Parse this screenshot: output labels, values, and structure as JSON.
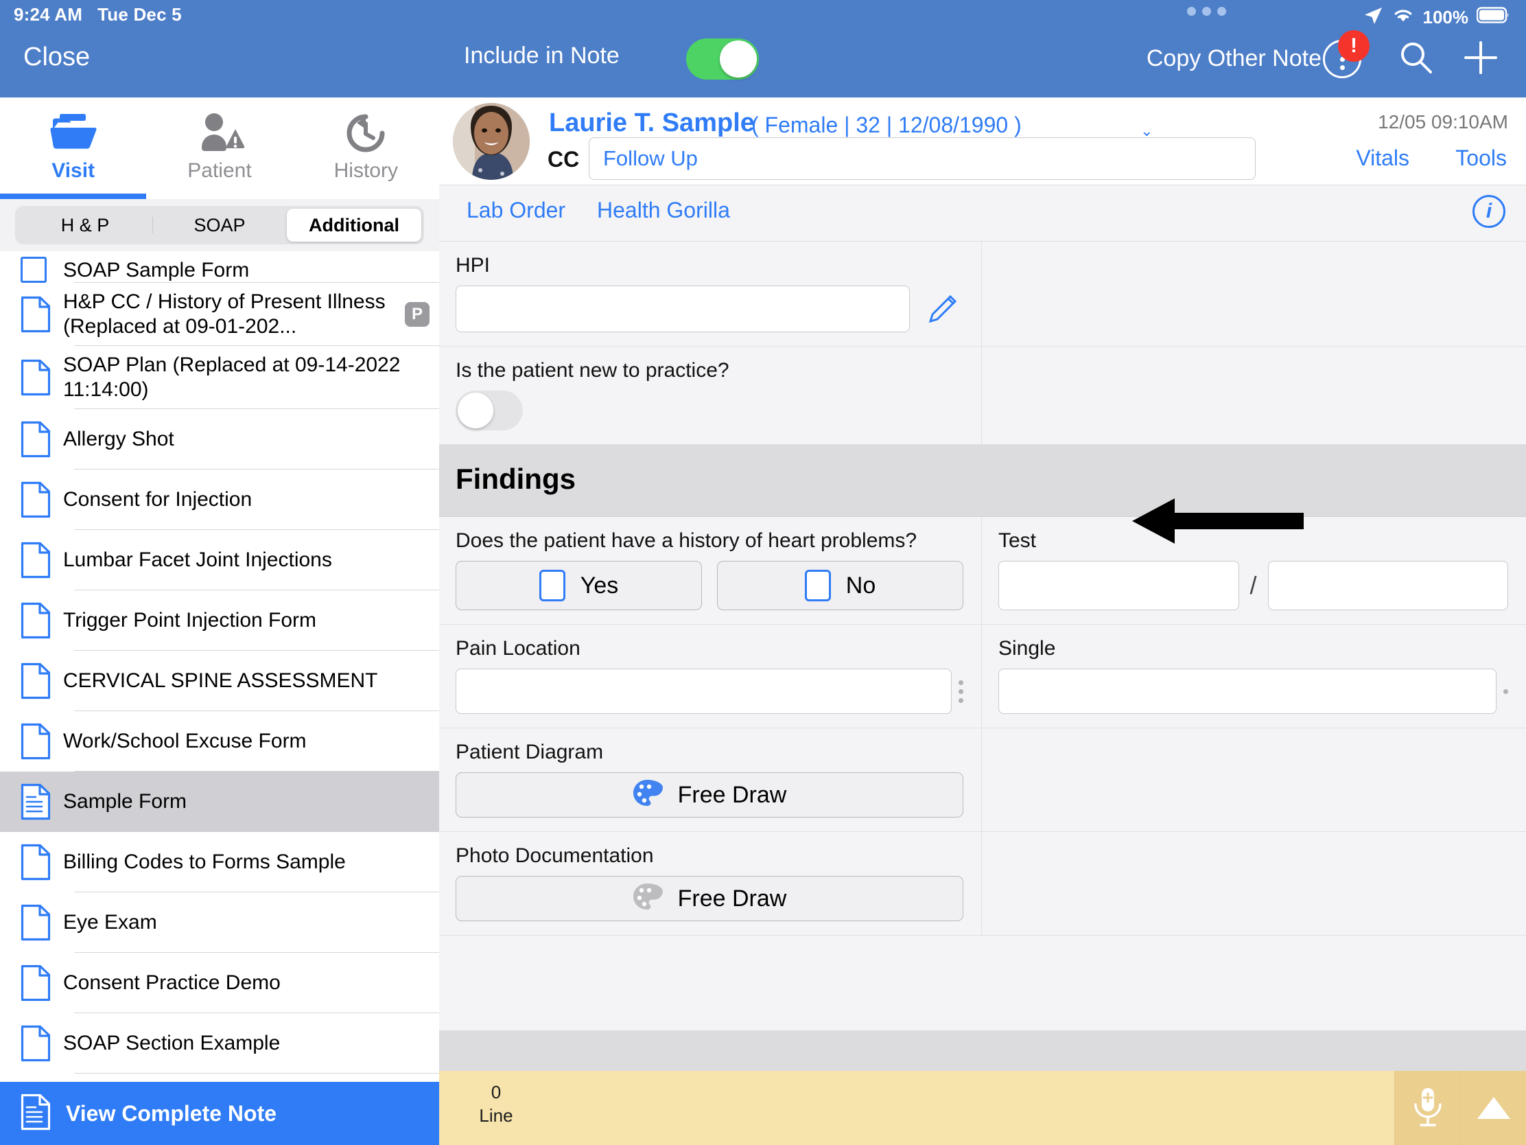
{
  "status_bar": {
    "time": "9:24 AM",
    "date": "Tue Dec 5",
    "battery_pct": "100%"
  },
  "left_panel": {
    "close_label": "Close",
    "tabs": [
      {
        "label": "Visit",
        "icon": "folder-icon",
        "active": true
      },
      {
        "label": "Patient",
        "icon": "person-warning-icon",
        "active": false
      },
      {
        "label": "History",
        "icon": "clock-history-icon",
        "active": false
      }
    ],
    "segmented": [
      {
        "label": "H & P",
        "selected": false
      },
      {
        "label": "SOAP",
        "selected": false
      },
      {
        "label": "Additional",
        "selected": true
      }
    ],
    "forms": [
      {
        "label": "SOAP Sample Form",
        "icon": "checkbox-icon",
        "clipped": true
      },
      {
        "label": "H&P CC / History of Present Illness (Replaced at 09-01-202...",
        "icon": "document-icon",
        "badge": "P"
      },
      {
        "label": "SOAP Plan (Replaced at 09-14-2022 11:14:00)",
        "icon": "document-icon"
      },
      {
        "label": "Allergy Shot",
        "icon": "document-icon"
      },
      {
        "label": "Consent for Injection",
        "icon": "document-icon"
      },
      {
        "label": "Lumbar Facet Joint Injections",
        "icon": "document-icon"
      },
      {
        "label": "Trigger Point Injection Form",
        "icon": "document-icon"
      },
      {
        "label": "CERVICAL SPINE ASSESSMENT",
        "icon": "document-icon"
      },
      {
        "label": "Work/School Excuse Form",
        "icon": "document-icon"
      },
      {
        "label": "Sample Form",
        "icon": "document-lines-icon",
        "selected": true
      },
      {
        "label": "Billing Codes to Forms Sample",
        "icon": "document-icon"
      },
      {
        "label": "Eye Exam",
        "icon": "document-icon"
      },
      {
        "label": "Consent Practice Demo",
        "icon": "document-icon"
      },
      {
        "label": "SOAP Section Example",
        "icon": "document-icon"
      }
    ],
    "view_complete_note": "View Complete Note"
  },
  "header": {
    "include_in_note_label": "Include in Note",
    "include_in_note_on": true,
    "copy_other_note_label": "Copy Other Note",
    "alert_badge": "!",
    "search_icon": "search-icon",
    "add_icon": "plus-icon"
  },
  "patient": {
    "name": "Laurie T. Sample",
    "demographics": "( Female | 32 | 12/08/1990 )",
    "cc_label": "CC",
    "cc_value": "Follow Up",
    "visit_timestamp": "12/05 09:10AM",
    "vitals_label": "Vitals",
    "tools_label": "Tools"
  },
  "order_bar": {
    "lab_order": "Lab Order",
    "health_gorilla": "Health Gorilla",
    "info_icon": "info-icon"
  },
  "form": {
    "hpi_label": "HPI",
    "hpi_value": "",
    "pencil_icon": "pencil-icon",
    "new_patient_question": "Is the patient new to practice?",
    "new_patient_toggle_on": false,
    "findings_title": "Findings",
    "heart_question": "Does the patient have a history of heart problems?",
    "yes_label": "Yes",
    "no_label": "No",
    "yes_checked": false,
    "no_checked": false,
    "pain_location_label": "Pain Location",
    "pain_location_value": "",
    "test_label": "Test",
    "test_value_1": "",
    "test_separator": "/",
    "test_value_2": "",
    "single_label": "Single",
    "single_value": "",
    "patient_diagram_label": "Patient Diagram",
    "patient_diagram_button": "Free Draw",
    "photo_documentation_label": "Photo Documentation",
    "photo_documentation_button": "Free Draw"
  },
  "bottom_bar": {
    "count": "0",
    "count_label": "Line",
    "mic_icon": "microphone-plus-icon",
    "collapse_icon": "triangle-up-icon"
  },
  "colors": {
    "header_blue": "#4d7ec8",
    "accent_blue": "#2f7cf6",
    "toggle_green": "#4cd364",
    "alert_red": "#f5342b",
    "bottom_yellow": "#f7e3ac",
    "section_grey": "#dcdcdf"
  }
}
